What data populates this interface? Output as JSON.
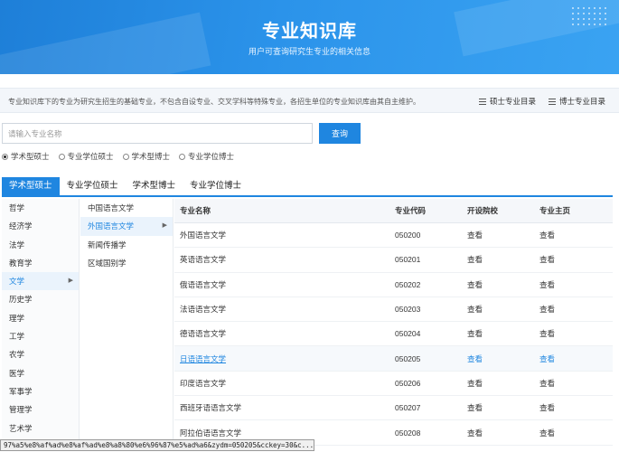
{
  "banner": {
    "title": "专业知识库",
    "subtitle": "用户可查询研究生专业的相关信息"
  },
  "notice": {
    "text": "专业知识库下的专业为研究生招生的基础专业，不包含自设专业、交叉学科等特殊专业，各招生单位的专业知识库由其自主维护。",
    "master_catalog": "硕士专业目录",
    "doctor_catalog": "博士专业目录"
  },
  "search": {
    "placeholder": "请输入专业名称",
    "button": "查询"
  },
  "radios": [
    {
      "label": "学术型硕士",
      "checked": true
    },
    {
      "label": "专业学位硕士",
      "checked": false
    },
    {
      "label": "学术型博士",
      "checked": false
    },
    {
      "label": "专业学位博士",
      "checked": false
    }
  ],
  "tabs": [
    {
      "label": "学术型硕士",
      "active": true
    },
    {
      "label": "专业学位硕士",
      "active": false
    },
    {
      "label": "学术型博士",
      "active": false
    },
    {
      "label": "专业学位博士",
      "active": false
    }
  ],
  "categories": [
    "哲学",
    "经济学",
    "法学",
    "教育学",
    "文学",
    "历史学",
    "理学",
    "工学",
    "农学",
    "医学",
    "军事学",
    "管理学",
    "艺术学"
  ],
  "active_category": "文学",
  "subcategories": [
    "中国语言文学",
    "外国语言文学",
    "新闻传播学",
    "区域国别学"
  ],
  "active_subcategory": "外国语言文学",
  "table": {
    "headers": [
      "专业名称",
      "专业代码",
      "开设院校",
      "专业主页"
    ],
    "rows": [
      {
        "name": "外国语言文学",
        "code": "050200",
        "school": "查看",
        "home": "查看"
      },
      {
        "name": "英语语言文学",
        "code": "050201",
        "school": "查看",
        "home": "查看"
      },
      {
        "name": "俄语语言文学",
        "code": "050202",
        "school": "查看",
        "home": "查看"
      },
      {
        "name": "法语语言文学",
        "code": "050203",
        "school": "查看",
        "home": "查看"
      },
      {
        "name": "德语语言文学",
        "code": "050204",
        "school": "查看",
        "home": "查看"
      },
      {
        "name": "日语语言文学",
        "code": "050205",
        "school": "查看",
        "home": "查看"
      },
      {
        "name": "印度语言文学",
        "code": "050206",
        "school": "查看",
        "home": "查看"
      },
      {
        "name": "西班牙语语言文学",
        "code": "050207",
        "school": "查看",
        "home": "查看"
      },
      {
        "name": "阿拉伯语语言文学",
        "code": "050208",
        "school": "查看",
        "home": "查看"
      }
    ],
    "highlighted_code": "050205"
  },
  "status_url": "97%a5%e8%af%ad%e8%af%ad%e8%a8%80%e6%96%87%e5%ad%a6&zydm=050205&cckey=30&c..."
}
